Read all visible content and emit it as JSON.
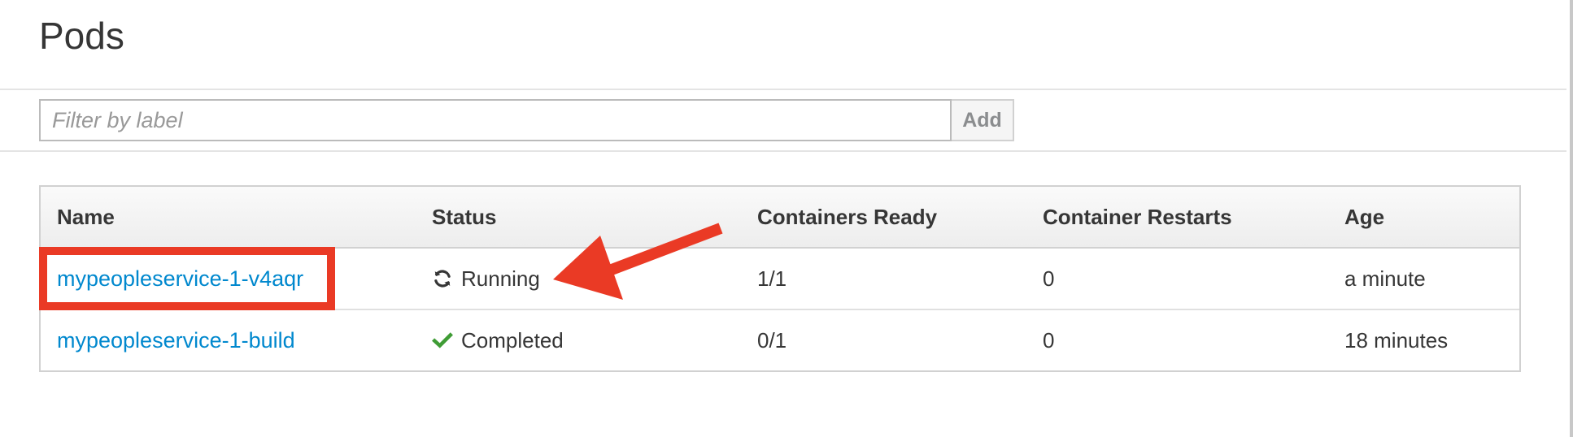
{
  "page": {
    "title": "Pods"
  },
  "filter": {
    "placeholder": "Filter by label",
    "value": "",
    "add_label": "Add"
  },
  "table": {
    "columns": [
      "Name",
      "Status",
      "Containers Ready",
      "Container Restarts",
      "Age"
    ],
    "rows": [
      {
        "name": "mypeopleservice-1-v4aqr",
        "status": "Running",
        "status_icon": "refresh-icon",
        "containers_ready": "1/1",
        "container_restarts": "0",
        "age": "a minute"
      },
      {
        "name": "mypeopleservice-1-build",
        "status": "Completed",
        "status_icon": "checkmark-icon",
        "containers_ready": "0/1",
        "container_restarts": "0",
        "age": "18 minutes"
      }
    ]
  },
  "colors": {
    "link": "#0088ce",
    "success": "#3f9c35",
    "annotation": "#ea3a25",
    "text": "#363636"
  },
  "annotations": {
    "highlight": "red-box-around-first-pod-name",
    "arrow": "red-arrow-pointing-to-running-status"
  }
}
